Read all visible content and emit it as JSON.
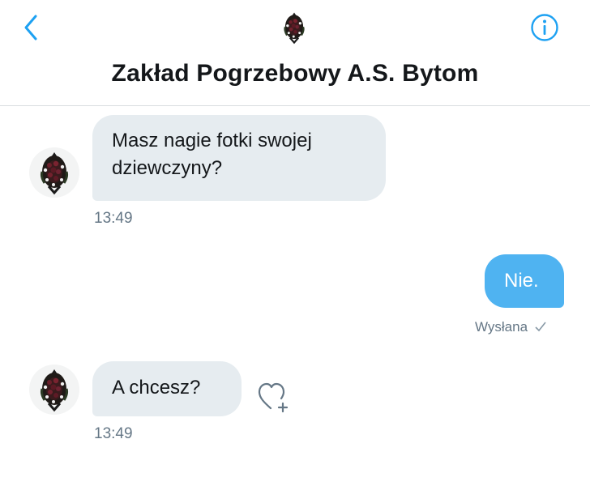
{
  "header": {
    "back_icon": "chevron-left-icon",
    "info_icon": "info-circle-icon",
    "title": "Zakład Pogrzebowy A.S. Bytom",
    "accent_color": "#1da1f2"
  },
  "messages": [
    {
      "direction": "incoming",
      "text_line1": "Masz nagie fotki swojej",
      "text_line2": "dziewczyny?",
      "time": "13:49"
    },
    {
      "direction": "outgoing",
      "text": "Nie.",
      "status": "Wysłana",
      "status_icon": "check-icon"
    },
    {
      "direction": "incoming",
      "text": "A chcesz?",
      "time": "13:49",
      "reaction_icon": "heart-add-icon"
    }
  ],
  "colors": {
    "incoming_bubble": "#e6ecf0",
    "outgoing_bubble": "#4fb3f1",
    "timestamp": "#657786"
  }
}
